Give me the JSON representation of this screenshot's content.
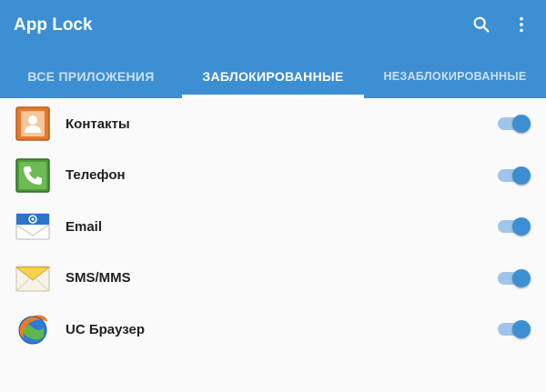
{
  "app": {
    "title": "App Lock",
    "accent_color": "#3d8fd3",
    "actions": [
      {
        "icon": "search-icon"
      },
      {
        "icon": "more-vert-icon"
      }
    ]
  },
  "tabs": [
    {
      "label": "ВСЕ ПРИЛОЖЕНИЯ",
      "active": false
    },
    {
      "label": "ЗАБЛОКИРОВАННЫЕ",
      "active": true
    },
    {
      "label": "НЕЗАБЛОКИРОВАННЫЕ",
      "active": false
    }
  ],
  "apps": [
    {
      "label": "Контакты",
      "icon": "contacts-icon",
      "locked": true
    },
    {
      "label": "Телефон",
      "icon": "phone-icon",
      "locked": true
    },
    {
      "label": "Email",
      "icon": "email-icon",
      "locked": true
    },
    {
      "label": "SMS/MMS",
      "icon": "sms-icon",
      "locked": true
    },
    {
      "label": "UC Браузер",
      "icon": "uc-browser-icon",
      "locked": true
    }
  ]
}
